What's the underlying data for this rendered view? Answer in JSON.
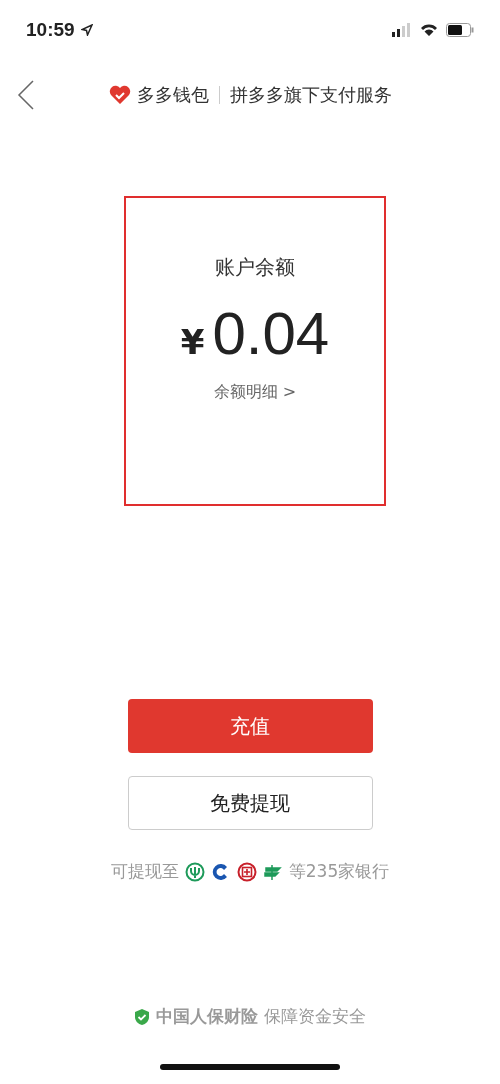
{
  "status_bar": {
    "time": "10:59"
  },
  "nav": {
    "brand": "多多钱包",
    "subtitle": "拼多多旗下支付服务"
  },
  "balance": {
    "label": "账户余额",
    "currency": "¥",
    "amount": "0.04",
    "detail_link": "余额明细 >"
  },
  "buttons": [
    {
      "label": "充值",
      "kind": "primary"
    },
    {
      "label": "免费提现",
      "kind": "secondary"
    }
  ],
  "withdraw_note": {
    "prefix": "可提现至",
    "suffix": "等235家银行"
  },
  "footer": {
    "text": "**中国人保财险** 保障资金安全"
  }
}
